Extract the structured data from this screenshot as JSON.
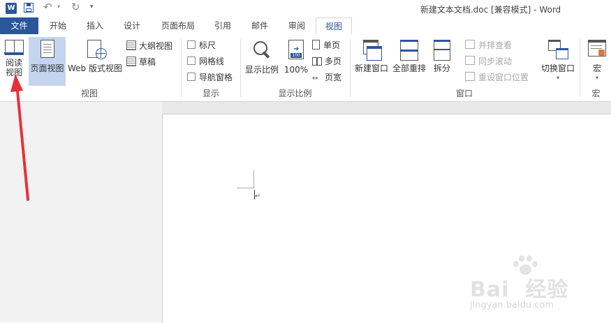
{
  "title_bar": {
    "app_icon_label": "W",
    "title": "新建文本文档.doc [兼容模式] - Word"
  },
  "tabs": [
    {
      "label": "文件"
    },
    {
      "label": "开始"
    },
    {
      "label": "插入"
    },
    {
      "label": "设计"
    },
    {
      "label": "页面布局"
    },
    {
      "label": "引用"
    },
    {
      "label": "邮件"
    },
    {
      "label": "审阅"
    },
    {
      "label": "视图"
    }
  ],
  "ribbon": {
    "views_group": {
      "label": "视图",
      "read_mode": "阅读\n视图",
      "print_layout": "页面视图",
      "web_layout": "Web 版式视图",
      "outline": "大纲视图",
      "draft": "草稿"
    },
    "show_group": {
      "label": "显示",
      "ruler": "标尺",
      "gridlines": "网格线",
      "nav_pane": "导航窗格"
    },
    "zoom_group": {
      "label": "显示比例",
      "zoom": "显示比例",
      "zoom_100": "100%",
      "one_page": "单页",
      "multi_page": "多页",
      "page_width": "页宽"
    },
    "window_group": {
      "label": "窗口",
      "new_window": "新建窗口",
      "arrange_all": "全部重排",
      "split": "拆分",
      "side_by_side": "并排查看",
      "sync_scroll": "同步滚动",
      "reset_position": "重设窗口位置",
      "switch_windows": "切换窗口"
    },
    "macros_group": {
      "label": "宏",
      "macros": "宏"
    }
  },
  "watermark": {
    "logo_text": "Bai  经验",
    "url": "jingyan.baidu.com"
  },
  "colors": {
    "accent": "#2b579a",
    "selected_bg": "#c5d5ef",
    "arrow": "#e8303a"
  }
}
